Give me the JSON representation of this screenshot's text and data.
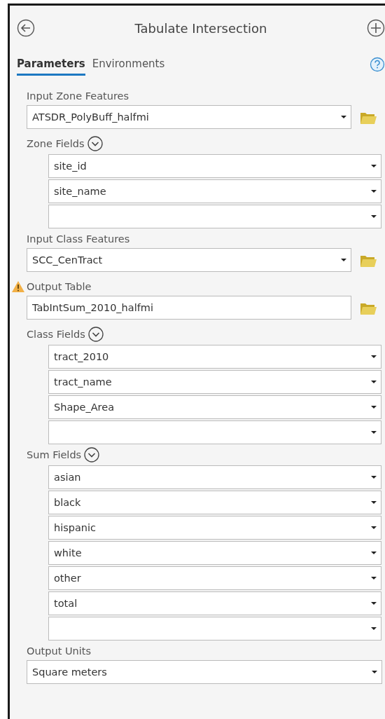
{
  "window": {
    "title": "Tabulate Intersection"
  },
  "tabs": [
    {
      "label": "Parameters",
      "selected": true
    },
    {
      "label": "Environments",
      "selected": false
    }
  ],
  "parameters": [
    {
      "kind": "dropdown",
      "label": "Input Zone Features",
      "value": "ATSDR_PolyBuff_halfmi",
      "browse": true,
      "warning": false
    },
    {
      "kind": "multivalue",
      "label": "Zone Fields",
      "expanded": true,
      "values": [
        "site_id",
        "site_name"
      ],
      "blank_row": true
    },
    {
      "kind": "dropdown",
      "label": "Input Class Features",
      "value": "SCC_CenTract",
      "browse": true,
      "warning": false
    },
    {
      "kind": "text",
      "label": "Output Table",
      "value": "TabIntSum_2010_halfmi",
      "browse": true,
      "warning": true
    },
    {
      "kind": "multivalue",
      "label": "Class Fields",
      "expanded": true,
      "values": [
        "tract_2010",
        "tract_name",
        "Shape_Area"
      ],
      "blank_row": true
    },
    {
      "kind": "multivalue",
      "label": "Sum Fields",
      "expanded": true,
      "values": [
        "asian",
        "black",
        "hispanic",
        "white",
        "other",
        "total"
      ],
      "blank_row": true
    },
    {
      "kind": "dropdown",
      "label": "Output Units",
      "value": "Square meters",
      "browse": false,
      "warning": false
    }
  ]
}
